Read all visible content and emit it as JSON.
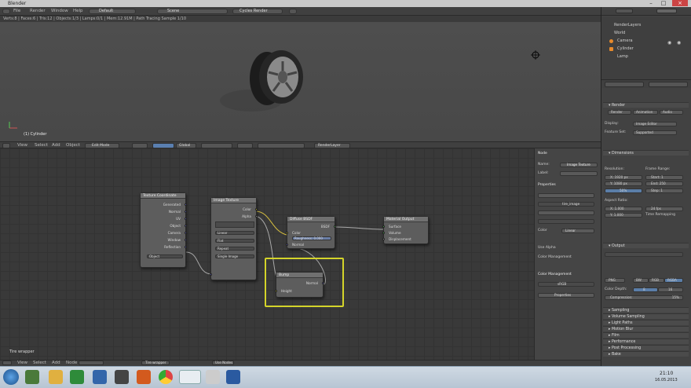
{
  "window": {
    "title": "Blender"
  },
  "topbar": {
    "menus": [
      "File",
      "Render",
      "Window",
      "Help"
    ],
    "layout": "Default",
    "scene": "Scene",
    "engine": "Cycles Render"
  },
  "infobar": {
    "text": "Verts:8 | Faces:6 | Tris:12 | Objects:1/3 | Lamps:0/1 | Mem:12.91M | Path Tracing Sample 1/10"
  },
  "viewport": {
    "object_label": "(1) Cylinder"
  },
  "viewport_header": {
    "menus": [
      "View",
      "Select",
      "Add",
      "Object"
    ],
    "mode": "Edit Mode",
    "pivot": "Global",
    "render_layer": "RenderLayer"
  },
  "node_editor": {
    "status": "Tire wrapper"
  },
  "node_editor_header": {
    "menus": [
      "View",
      "Select",
      "Add",
      "Node"
    ],
    "tree": "Tire wrapper",
    "use_nodes": "Use Nodes"
  },
  "nodes": {
    "texcoord": {
      "title": "Texture Coordinate",
      "outputs": [
        "Generated",
        "Normal",
        "UV",
        "Object",
        "Camera",
        "Window",
        "Reflection"
      ],
      "field": "Object"
    },
    "image": {
      "title": "Image Texture",
      "outputs": [
        "Color",
        "Alpha"
      ],
      "fields": [
        "Linear",
        "Flat",
        "Repeat",
        "Single Image"
      ]
    },
    "diffuse": {
      "title": "Diffuse BSDF",
      "inputs": [
        "Color",
        "Roughness: 0.000",
        "Normal"
      ],
      "outputs": [
        "BSDF"
      ]
    },
    "output": {
      "title": "Material Output",
      "inputs": [
        "Surface",
        "Volume",
        "Displacement"
      ]
    },
    "bump": {
      "title": "Bump",
      "inputs": [
        "Height"
      ],
      "outputs": [
        "Normal"
      ]
    }
  },
  "ne_props": {
    "section": "Node",
    "name_label": "Name:",
    "name_value": "Image Texture",
    "label_label": "Label:",
    "properties": "Properties",
    "image": "tire_image",
    "color": "Color",
    "color_space": "Linear",
    "use_alpha": "Use Alpha",
    "color_mgmt": "Color Management",
    "color_mgmt_value": "sRGB",
    "btn": "Properties"
  },
  "outliner": {
    "items": [
      "RenderLayers",
      "World",
      "Camera",
      "Cylinder",
      "Lamp"
    ]
  },
  "properties": {
    "tabs": [
      "Render",
      "Animation",
      "Audio"
    ],
    "display_label": "Display:",
    "display_value": "Image Editor",
    "feature_label": "Feature Set:",
    "feature_value": "Supported",
    "resolution": "Resolution:",
    "res_x": "X: 1920 px",
    "res_y": "Y: 1080 px",
    "res_pct": "50%",
    "frame_range": "Frame Range:",
    "start": "Start: 1",
    "end": "End: 250",
    "step": "Step: 1",
    "aspect": "Aspect Ratio:",
    "ax": "X: 1.000",
    "ay": "Y: 1.000",
    "fps": "24 fps",
    "time": "Time Remapping",
    "dim": "Dimensions",
    "output": "Output",
    "fmt": "PNG",
    "bw": "BW",
    "rgb": "RGB",
    "rgba": "RGBA",
    "depth": "Color Depth:",
    "depth8": "8",
    "depth16": "16",
    "compression": "Compression:",
    "comp_val": "15%",
    "sections": [
      "Sampling",
      "Volume Sampling",
      "Light Paths",
      "Motion Blur",
      "Film",
      "Performance",
      "Post Processing",
      "Bake"
    ]
  },
  "taskbar": {
    "time": "21:10",
    "date": "16.05.2013"
  }
}
